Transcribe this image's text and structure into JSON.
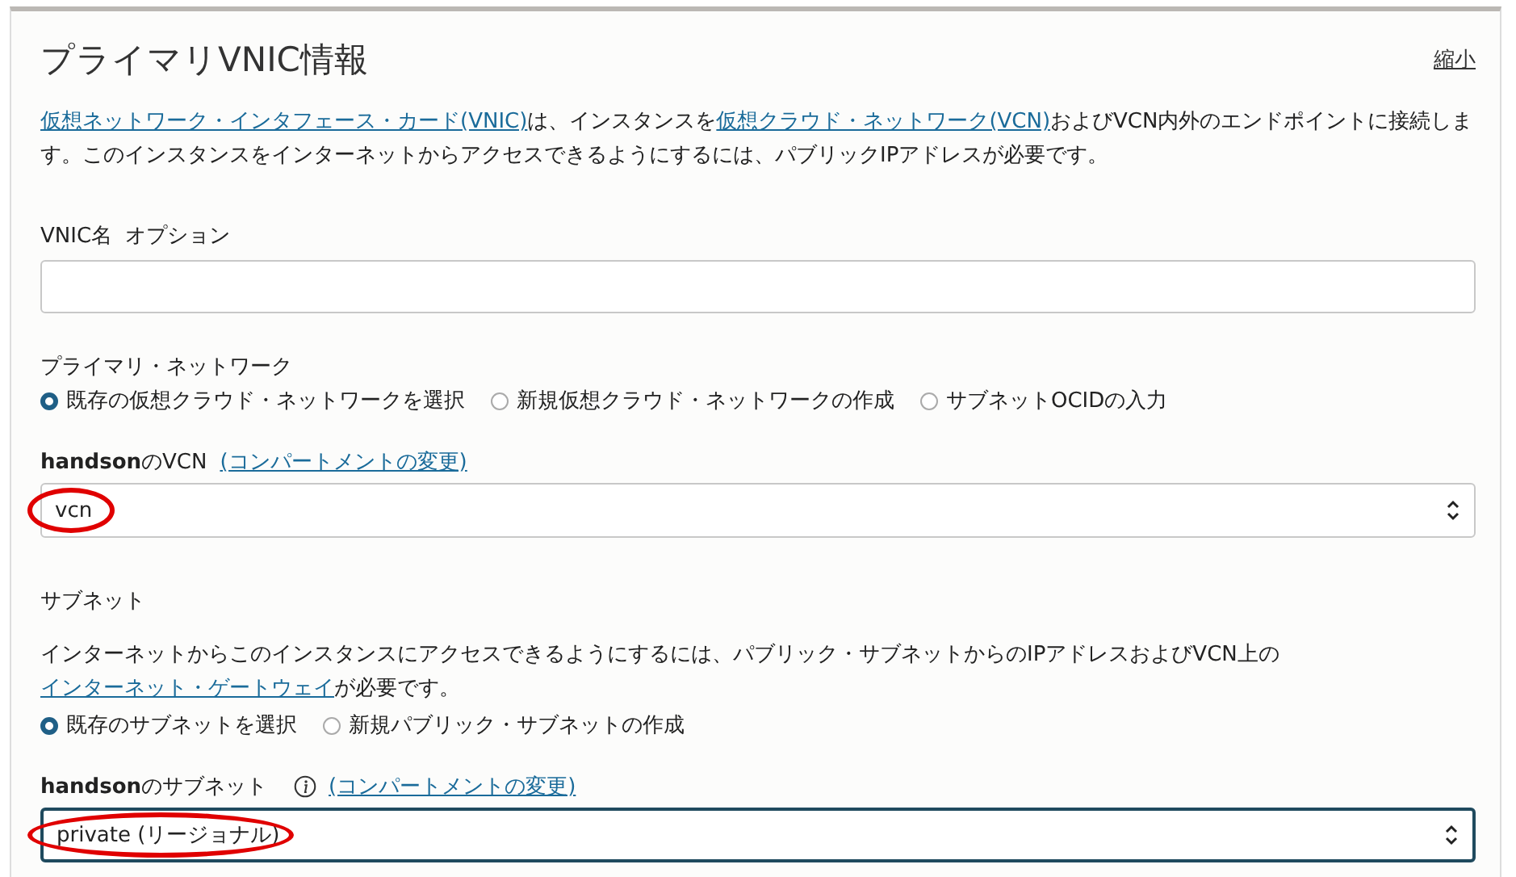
{
  "title": "プライマリVNIC情報",
  "collapse_link": "縮小",
  "description": [
    {
      "text": "仮想ネットワーク・インタフェース・カード(VNIC)",
      "link": true
    },
    {
      "text": "は、インスタンスを",
      "link": false
    },
    {
      "text": "仮想クラウド・ネットワーク(VCN)",
      "link": true
    },
    {
      "text": "およびVCN内外のエンドポイントに接続します。このインスタンスをインターネットからアクセスできるようにするには、パブリックIPアドレスが必要です。",
      "link": false
    }
  ],
  "vnic_name": {
    "label": "VNIC名",
    "optional": "オプション"
  },
  "primary_network": {
    "label": "プライマリ・ネットワーク",
    "options": [
      {
        "label": "既存の仮想クラウド・ネットワークを選択",
        "selected": true
      },
      {
        "label": "新規仮想クラウド・ネットワークの作成",
        "selected": false
      },
      {
        "label": "サブネットOCIDの入力",
        "selected": false
      }
    ]
  },
  "vcn": {
    "label": "**handson**のVCN",
    "info": false,
    "link": "(コンパートメントの変更)",
    "value": "vcn",
    "focused": false,
    "highlighted": true
  },
  "subnet_section": {
    "label": "サブネット",
    "description": [
      {
        "text": "インターネットからこのインスタンスにアクセスできるようにするには、パブリック・サブネットからのIPアドレスおよびVCN上の",
        "link": false
      },
      {
        "text": "インターネット・ゲートウェイ",
        "link": true
      },
      {
        "text": "が必要です。",
        "link": false
      }
    ],
    "options": [
      {
        "label": "既存のサブネットを選択",
        "selected": true
      },
      {
        "label": "新規パブリック・サブネットの作成",
        "selected": false
      }
    ]
  },
  "subnet": {
    "label": "**handson**のサブネット",
    "info": true,
    "link": "(コンパートメントの変更)",
    "value": "private (リージョナル)",
    "focused": true,
    "highlighted": true
  }
}
